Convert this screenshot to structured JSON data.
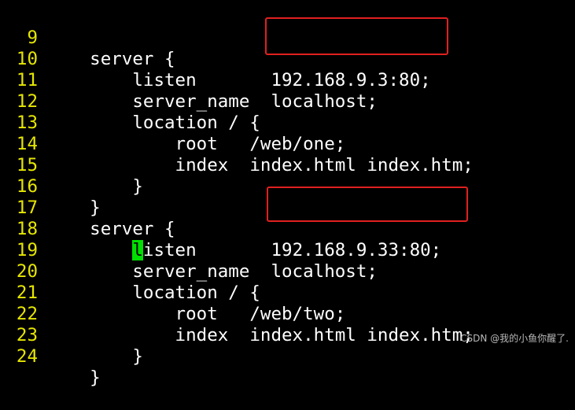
{
  "colors": {
    "background": "#000000",
    "line_number": "#e6e600",
    "code_text": "#ffffff",
    "cursor": "#00e000",
    "annotation_box": "#e02020"
  },
  "lines": [
    {
      "number": "9",
      "text": "    server {"
    },
    {
      "number": "10",
      "text": "        listen       192.168.9.3:80;"
    },
    {
      "number": "11",
      "text": "        server_name  localhost;"
    },
    {
      "number": "12",
      "text": "        location / {"
    },
    {
      "number": "13",
      "text": "            root   /web/one;"
    },
    {
      "number": "14",
      "text": "            index  index.html index.htm;"
    },
    {
      "number": "15",
      "text": "        }"
    },
    {
      "number": "16",
      "text": "    }"
    },
    {
      "number": "17",
      "text": "    server {"
    },
    {
      "number": "18",
      "text_before_cursor": "        ",
      "cursor_char": "l",
      "text_after_cursor": "isten       192.168.9.33:80;"
    },
    {
      "number": "19",
      "text": "        server_name  localhost;"
    },
    {
      "number": "20",
      "text": "        location / {"
    },
    {
      "number": "21",
      "text": "            root   /web/two;"
    },
    {
      "number": "22",
      "text": "            index  index.html index.htm;"
    },
    {
      "number": "23",
      "text": "        }"
    },
    {
      "number": "24",
      "text": "    }"
    }
  ],
  "watermark": "CSDN @我的小鱼你醒了."
}
